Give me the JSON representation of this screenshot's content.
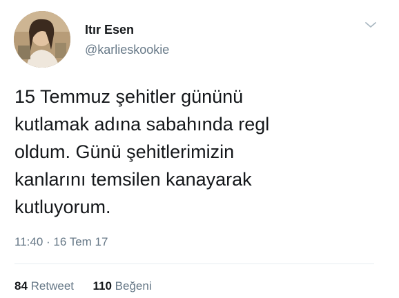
{
  "user": {
    "name": "Itır Esen",
    "handle": "@karlieskookie"
  },
  "tweet": {
    "lines": [
      "15 Temmuz şehitler gününü",
      "kutlamak adına sabahında regl",
      "oldum. Günü şehitlerimizin",
      "kanlarını temsilen kanayarak",
      "kutluyorum."
    ],
    "timestamp": "11:40 · 16 Tem 17"
  },
  "stats": {
    "retweets_count": "84",
    "retweets_label": "Retweet",
    "likes_count": "110",
    "likes_label": "Beğeni"
  },
  "icons": {
    "menu": "chevron-down-icon"
  },
  "colors": {
    "text": "#14171a",
    "secondary": "#657786",
    "divider": "#e6ecf0"
  }
}
